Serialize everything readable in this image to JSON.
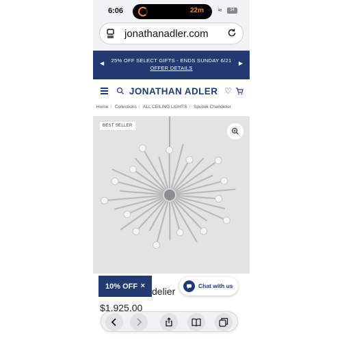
{
  "status_bar": {
    "time": "6:06",
    "timer": "22m",
    "battery": "34"
  },
  "browser": {
    "url": "jonathanadler.com"
  },
  "promo": {
    "line1": "25% OFF SELECT GIFTS - ENDS SUNDAY 6/21",
    "line2": "OFFER DETAILS"
  },
  "header": {
    "logo": "JONATHAN ADLER"
  },
  "breadcrumb": [
    "Home",
    "Collections",
    "ALL CEILING LIGHTS",
    "Sputnik Chandelier"
  ],
  "product": {
    "badge": "BEST SELLER",
    "title_visible": "delier",
    "price": "$1,925.00"
  },
  "promo_button": {
    "label": "10% OFF",
    "close": "×"
  },
  "chat": {
    "label": "Chat with us"
  },
  "colors": {
    "brand_navy": "#223a70",
    "accent_orange": "#f28a1d"
  }
}
